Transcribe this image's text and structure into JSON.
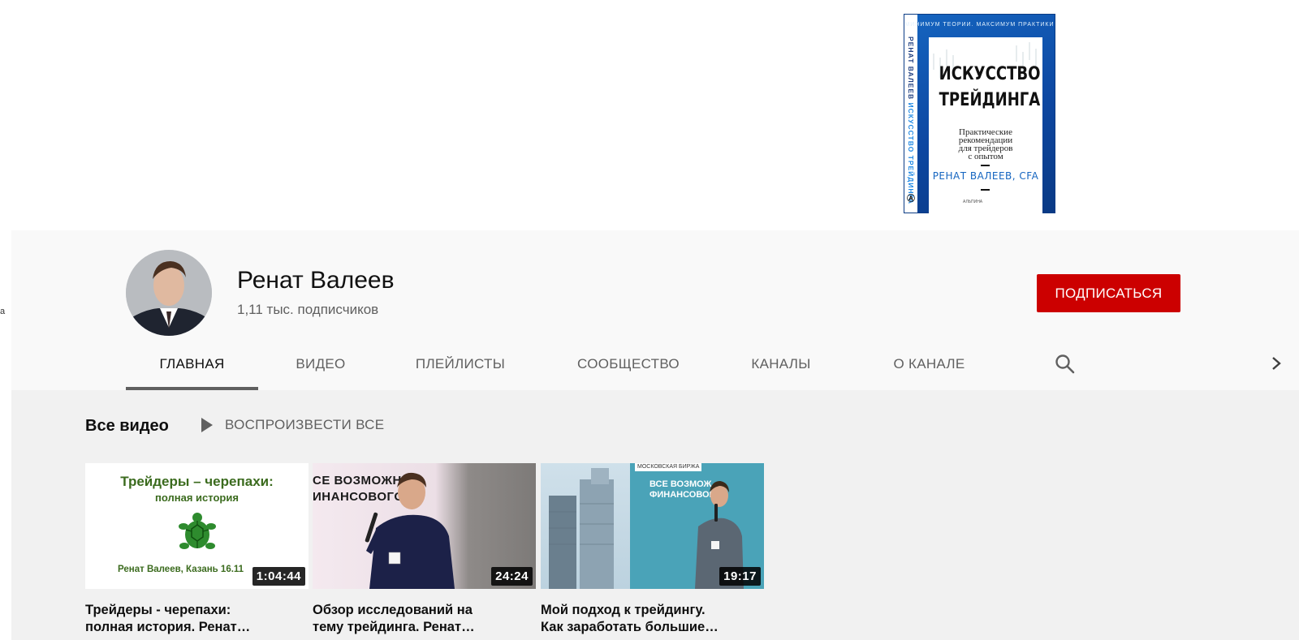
{
  "left_edge_text": "а",
  "book": {
    "top_text": "МИНИМУМ ТЕОРИИ. МАКСИМУМ ПРАКТИКИ",
    "spine_author": "РЕНАТ ВАЛЕЕВ",
    "spine_title": "ИСКУССТВО ТРЕЙДИНГА",
    "title_line1": "ИСКУССТВО",
    "title_line2": "ТРЕЙДИНГА",
    "subtitle_line1": "Практические",
    "subtitle_line2": "рекомендации",
    "subtitle_line3": "для трейдеров",
    "subtitle_line4": "с опытом",
    "author_first": "РЕНАТ",
    "author_last": "ВАЛЕЕВ, CFA",
    "publisher": "АЛЬПИНА"
  },
  "channel": {
    "name": "Ренат Валеев",
    "subscribers": "1,11 тыс. подписчиков",
    "subscribe_label": "ПОДПИСАТЬСЯ"
  },
  "tabs": [
    {
      "label": "ГЛАВНАЯ",
      "active": true
    },
    {
      "label": "ВИДЕО",
      "active": false
    },
    {
      "label": "ПЛЕЙЛИСТЫ",
      "active": false
    },
    {
      "label": "СООБЩЕСТВО",
      "active": false
    },
    {
      "label": "КАНАЛЫ",
      "active": false
    },
    {
      "label": "О КАНАЛЕ",
      "active": false
    }
  ],
  "shelf": {
    "title": "Все видео",
    "play_all_label": "ВОСПРОИЗВЕСТИ ВСЕ"
  },
  "videos": [
    {
      "duration": "1:04:44",
      "title_line1": "Трейдеры - черепахи:",
      "title_line2": "полная история. Ренат…",
      "thumb_title": "Трейдеры – черепахи:",
      "thumb_sub": "полная история",
      "thumb_author": "Ренат Валеев, Казань 16.11"
    },
    {
      "duration": "24:24",
      "title_line1": "Обзор исследований на",
      "title_line2": "тему трейдинга. Ренат…",
      "thumb_text_line1": "СЕ ВОЗМОЖН",
      "thumb_text_line2": "ИНАНСОВОГО"
    },
    {
      "duration": "19:17",
      "title_line1": "Мой подход к трейдингу.",
      "title_line2": "Как заработать большие…",
      "thumb_logo": "МОСКОВСКАЯ БИРЖА",
      "thumb_text_line1": "ВСЕ ВОЗМОЖ",
      "thumb_text_line2": "ФИНАНСОВОГО"
    }
  ]
}
